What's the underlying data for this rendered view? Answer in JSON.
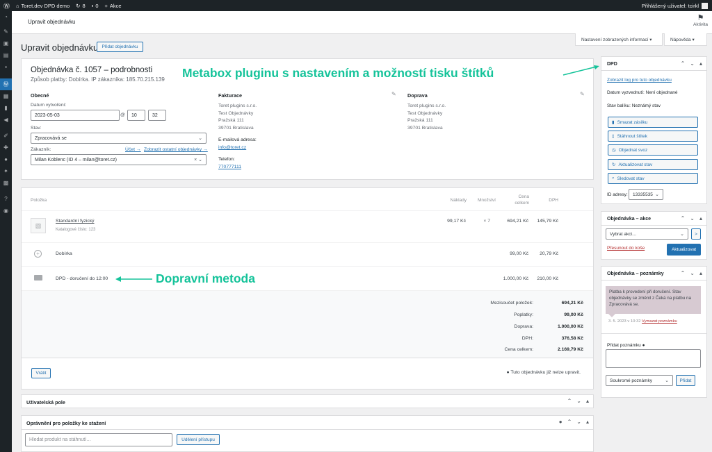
{
  "adminbar": {
    "site_name": "Toret.dev DPD demo",
    "updates_count": "8",
    "comments_count": "0",
    "new_label": "Akce",
    "user_greeting": "Přihlášený uživatel: tcirkl"
  },
  "header": {
    "title": "Upravit objednávku",
    "activity_label": "Aktivita"
  },
  "screen_meta": {
    "options_label": "Nastavení zobrazených informací ▾",
    "help_label": "Nápověda ▾"
  },
  "page": {
    "title": "Upravit objednávku",
    "add_order_label": "Přidat objednávku"
  },
  "order": {
    "heading": "Objednávka č. 1057 – podrobnosti",
    "subtitle": "Způsob platby: Dobírka. IP zákazníka: 185.70.215.139",
    "general": {
      "section_title": "Obecné",
      "date_label": "Datum vytvoření:",
      "date_value": "2023-05-03",
      "hour_value": "10",
      "minute_value": "32",
      "time_sep": "@",
      "status_label": "Stav:",
      "status_value": "Zpracovává se",
      "customer_label": "Zákazník:",
      "profile_link": "Účet →",
      "other_orders_link": "Zobrazit ostatní objednávky →",
      "customer_value": "Milan Koblenc (ID 4 – milan@toret.cz)"
    },
    "billing": {
      "section_title": "Fakturace",
      "address_lines": [
        "Toret plugins s.r.o.",
        "Test Objednávky",
        "Pražská 111",
        "39701 Bratislava"
      ],
      "email_label": "E-mailová adresa:",
      "email_value": "info@toret.cz",
      "phone_label": "Telefon:",
      "phone_value": "770777111"
    },
    "shipping": {
      "section_title": "Doprava",
      "address_lines": [
        "Toret plugins s.r.o.",
        "Test Objednávky",
        "Pražská 111",
        "39701 Bratislava"
      ]
    }
  },
  "items": {
    "headers": {
      "item": "Položka",
      "cost": "Náklady",
      "qty": "Množství",
      "total_line1": "Cena",
      "total_line2": "celkem",
      "tax": "DPH"
    },
    "product": {
      "name": "Standardní fyzický",
      "sku_label": "Katalogové číslo:",
      "sku_value": "123",
      "cost": "99,17 Kč",
      "qty": "× 7",
      "total": "694,21 Kč",
      "tax": "145,79 Kč"
    },
    "fee": {
      "name": "Dobírka",
      "total": "99,00 Kč",
      "tax": "20,79 Kč"
    },
    "shipping": {
      "name": "DPD - doručení do 12:00",
      "total": "1.000,00 Kč",
      "tax": "210,00 Kč"
    },
    "totals": [
      {
        "label": "Mezisoučet položek:",
        "value": "694,21 Kč"
      },
      {
        "label": "Poplatky:",
        "value": "99,00 Kč"
      },
      {
        "label": "Doprava:",
        "value": "1.000,00 Kč"
      },
      {
        "label": "DPH:",
        "value": "376,58 Kč"
      },
      {
        "label": "Cena celkem:",
        "value": "2.169,79 Kč"
      }
    ],
    "refund_label": "Vrátit",
    "not_editable_note": "Tuto objednávku již nelze upravit."
  },
  "custom_fields": {
    "title": "Uživatelská pole"
  },
  "downloads": {
    "title": "Oprávnění pro položky ke stažení",
    "search_placeholder": "Hledat produkt na stáhnutí…",
    "grant_label": "Udělení přístupu"
  },
  "dpd_box": {
    "title": "DPD",
    "log_link": "Zobrazit log pro tuto objednávku",
    "pickup_label": "Datum vyzvednutí: Není objednané",
    "parcel_label": "Stav balíku: Neznámý stav",
    "buttons": [
      "Smazat zásilku",
      "Stáhnout štítek",
      "Objednat svoz",
      "Aktualizovat stav",
      "Sledovat stav"
    ],
    "address_id_label": "ID adresy:",
    "address_id_value": "13335535"
  },
  "order_actions": {
    "title": "Objednávka – akce",
    "select_placeholder": "Vybrat akci…",
    "go_label": ">",
    "trash_link": "Přesunout do koše",
    "update_label": "Aktualizovat"
  },
  "order_notes": {
    "title": "Objednávka – poznámky",
    "note_text": "Platba k provedení při doručení. Stav objednávky se změnil z Čeká na platbu na Zpracovává se.",
    "note_date": "3. 5. 2023 v 10:32",
    "delete_link": "Vymazat poznámku",
    "add_label": "Přidat poznámku",
    "type_value": "Soukromé poznámky",
    "add_button": "Přidat"
  },
  "annotations": {
    "metabox": "Metabox pluginu s nastavením a možností tisku štítků",
    "shipping_method": "Dopravní metoda"
  },
  "colors": {
    "accent": "#2271b1",
    "annotation": "#15c39a",
    "note_bg": "#d7cad2"
  }
}
